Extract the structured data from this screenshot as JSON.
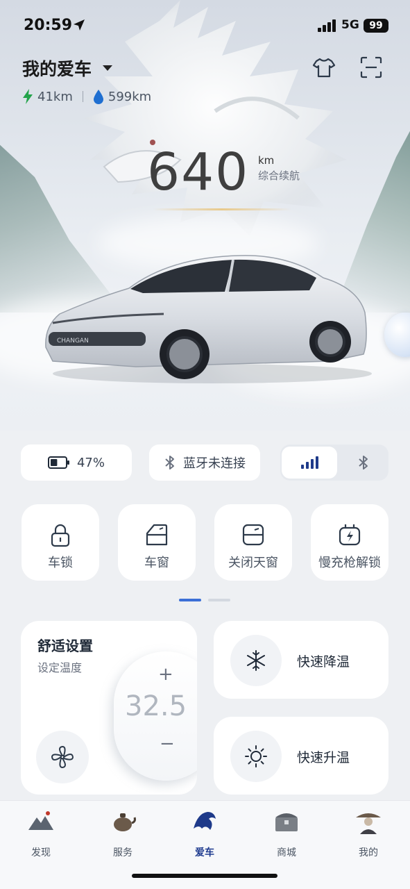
{
  "status_bar": {
    "time": "20:59",
    "network": "5G",
    "battery": "99"
  },
  "header": {
    "title": "我的爱车",
    "electric_range": "41km",
    "fuel_range": "599km",
    "icons": [
      "tshirt-icon",
      "scan-icon"
    ]
  },
  "hero": {
    "range_value": "640",
    "range_unit": "km",
    "range_label": "综合续航"
  },
  "quick_status": {
    "battery_percent": "47%",
    "battery_level": 0.47,
    "bluetooth_text": "蓝牙未连接",
    "segment_selected": "signal",
    "segment_options": [
      "signal-icon",
      "bluetooth-icon"
    ]
  },
  "controls": [
    {
      "label": "车锁",
      "icon": "lock-icon"
    },
    {
      "label": "车窗",
      "icon": "window-icon"
    },
    {
      "label": "关闭天窗",
      "icon": "sunroof-icon"
    },
    {
      "label": "慢充枪解锁",
      "icon": "charger-icon"
    }
  ],
  "pager": {
    "pages": 2,
    "current": 1
  },
  "comfort": {
    "title": "舒适设置",
    "subtitle": "设定温度",
    "temperature": "32.5",
    "plus": "+",
    "minus": "−"
  },
  "actions": [
    {
      "label": "快速降温",
      "icon": "snowflake-icon"
    },
    {
      "label": "快速升温",
      "icon": "sun-icon"
    }
  ],
  "nav": {
    "active": "爱车",
    "items": [
      {
        "label": "发现"
      },
      {
        "label": "服务"
      },
      {
        "label": "爱车"
      },
      {
        "label": "商城"
      },
      {
        "label": "我的"
      }
    ]
  }
}
